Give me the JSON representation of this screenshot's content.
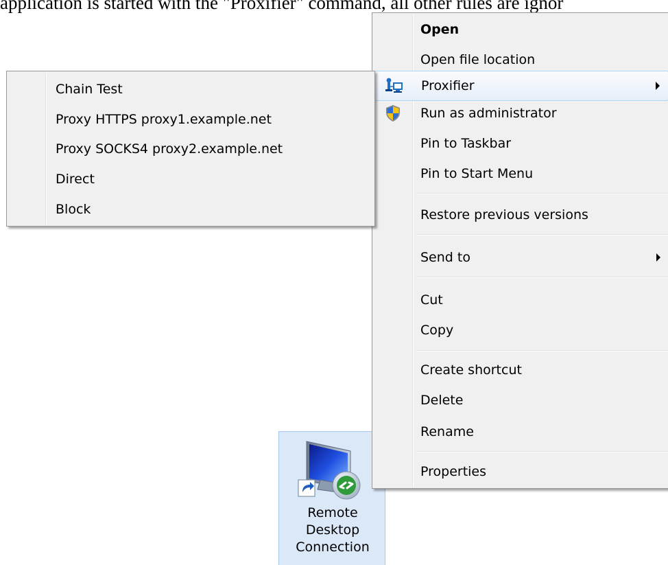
{
  "document": {
    "text": "application is started with the \"Proxifier\" command, all other rules are ignor"
  },
  "desktop_icon": {
    "name_lines": [
      "Remote",
      "Desktop",
      "Connection"
    ]
  },
  "context_menu": {
    "items": [
      {
        "label": "Open",
        "bold": true
      },
      {
        "label": "Open file location"
      },
      {
        "label": "Proxifier",
        "icon": "proxifier-icon",
        "submenu": true,
        "highlighted": true
      },
      {
        "label": "Run as administrator",
        "icon": "uac-shield-icon"
      },
      {
        "label": "Pin to Taskbar"
      },
      {
        "label": "Pin to Start Menu"
      },
      {
        "label": "Restore previous versions"
      },
      {
        "label": "Send to",
        "submenu": true
      },
      {
        "label": "Cut"
      },
      {
        "label": "Copy"
      },
      {
        "label": "Create shortcut"
      },
      {
        "label": "Delete"
      },
      {
        "label": "Rename"
      },
      {
        "label": "Properties"
      }
    ]
  },
  "proxifier_submenu": {
    "items": [
      {
        "label": "Chain Test"
      },
      {
        "label": "Proxy HTTPS proxy1.example.net"
      },
      {
        "label": "Proxy SOCKS4 proxy2.example.net"
      },
      {
        "label": "Direct"
      },
      {
        "label": "Block"
      }
    ]
  },
  "colors": {
    "menu_background": "#f0f0f0",
    "highlight_border": "#a8d8f8",
    "icon_selection": "#dbe8f8"
  }
}
